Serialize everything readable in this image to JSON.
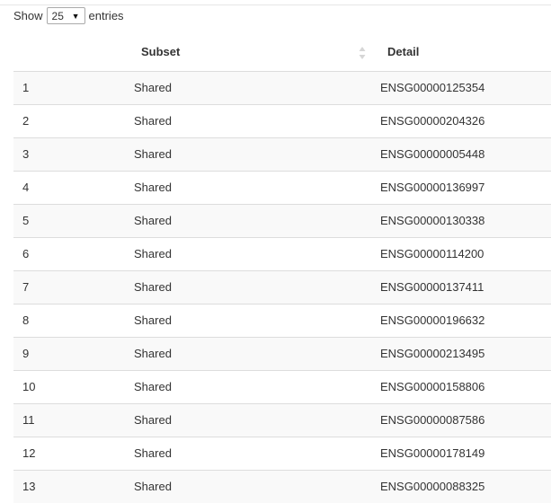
{
  "length_menu": {
    "prefix": "Show",
    "selected": "25",
    "suffix": "entries"
  },
  "table": {
    "columns": [
      "",
      "Subset",
      "Detail"
    ],
    "rows": [
      {
        "idx": "1",
        "subset": "Shared",
        "detail": "ENSG00000125354"
      },
      {
        "idx": "2",
        "subset": "Shared",
        "detail": "ENSG00000204326"
      },
      {
        "idx": "3",
        "subset": "Shared",
        "detail": "ENSG00000005448"
      },
      {
        "idx": "4",
        "subset": "Shared",
        "detail": "ENSG00000136997"
      },
      {
        "idx": "5",
        "subset": "Shared",
        "detail": "ENSG00000130338"
      },
      {
        "idx": "6",
        "subset": "Shared",
        "detail": "ENSG00000114200"
      },
      {
        "idx": "7",
        "subset": "Shared",
        "detail": "ENSG00000137411"
      },
      {
        "idx": "8",
        "subset": "Shared",
        "detail": "ENSG00000196632"
      },
      {
        "idx": "9",
        "subset": "Shared",
        "detail": "ENSG00000213495"
      },
      {
        "idx": "10",
        "subset": "Shared",
        "detail": "ENSG00000158806"
      },
      {
        "idx": "11",
        "subset": "Shared",
        "detail": "ENSG00000087586"
      },
      {
        "idx": "12",
        "subset": "Shared",
        "detail": "ENSG00000178149"
      },
      {
        "idx": "13",
        "subset": "Shared",
        "detail": "ENSG00000088325"
      }
    ]
  },
  "colors": {
    "row_stripe": "#f9f9f9",
    "row_border": "#dddddd",
    "text": "#333333"
  },
  "icons": {
    "select_caret": "chevron-down-icon",
    "sort": "sort-both-icon"
  }
}
